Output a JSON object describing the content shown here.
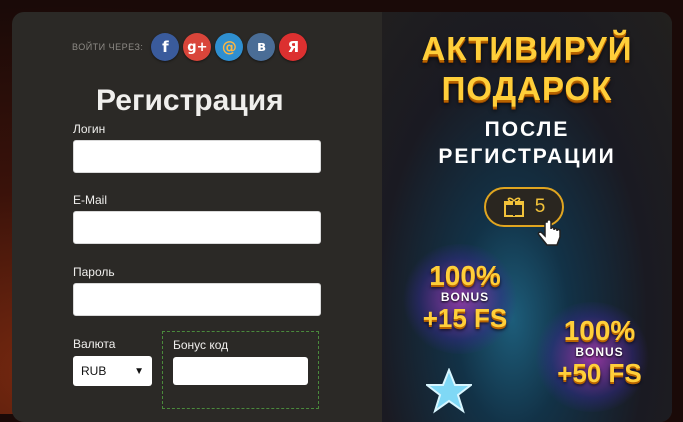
{
  "social": {
    "label": "ВОЙТИ ЧЕРЕЗ:",
    "buttons": [
      {
        "name": "facebook",
        "glyph": "f",
        "color": "#3a5b9c"
      },
      {
        "name": "google-plus",
        "glyph": "g+",
        "color": "#d9453a"
      },
      {
        "name": "mail-ru",
        "glyph": "@",
        "color": "#2f8fd0"
      },
      {
        "name": "vkontakte",
        "glyph": "в",
        "color": "#4a6d96"
      },
      {
        "name": "yandex",
        "glyph": "Я",
        "color": "#dc3030"
      }
    ]
  },
  "form": {
    "title": "Регистрация",
    "login_label": "Логин",
    "email_label": "E-Mail",
    "password_label": "Пароль",
    "currency_label": "Валюта",
    "currency_value": "RUB",
    "bonus_label": "Бонус код"
  },
  "promo": {
    "headline_1": "АКТИВИРУЙ",
    "headline_2": "ПОДАРОК",
    "sub_1": "ПОСЛЕ",
    "sub_2": "РЕГИСТРАЦИИ",
    "gift_count": "5",
    "bonus_1_percent": "100%",
    "bonus_1_word": "BONUS",
    "bonus_1_fs": "+15 FS",
    "bonus_2_percent": "100%",
    "bonus_2_word": "BONUS",
    "bonus_2_fs": "+50 FS"
  }
}
